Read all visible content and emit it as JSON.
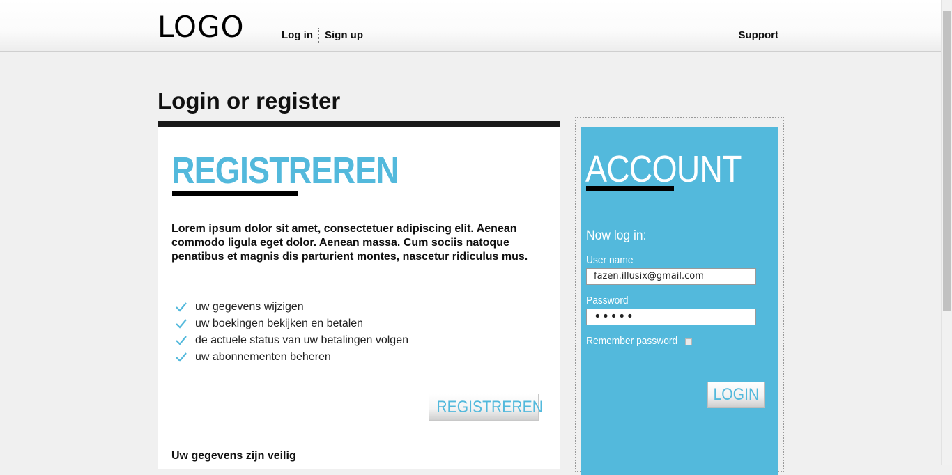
{
  "header": {
    "logo": "LOGO",
    "nav": [
      "Log in",
      "Sign up"
    ],
    "support": "Support"
  },
  "page_title": "Login or register",
  "register": {
    "heading": "REGISTREREN",
    "intro": "Lorem ipsum dolor sit amet, consectetuer adipiscing elit. Aenean commodo ligula eget dolor. Aenean massa. Cum sociis natoque penatibus et magnis dis parturient montes, nascetur ridiculus mus.",
    "benefits": [
      "uw gegevens wijzigen",
      "uw boekingen bekijken en betalen",
      "de actuele status van uw betalingen volgen",
      "uw abonnementen beheren"
    ],
    "button_label": "REGISTREREN",
    "safe_text": "Uw gegevens zijn veilig"
  },
  "account": {
    "heading": "ACCOUNT",
    "subheading": "Now log in:",
    "username_label": "User name",
    "username_value": "fazen.illusix@gmail.com",
    "password_label": "Password",
    "password_value": "•••••",
    "remember_label": "Remember password",
    "login_label": "LOGIN"
  },
  "colors": {
    "accent": "#53b9dc",
    "background": "#f0f0f0",
    "dark_bar": "#1a1a1a"
  }
}
